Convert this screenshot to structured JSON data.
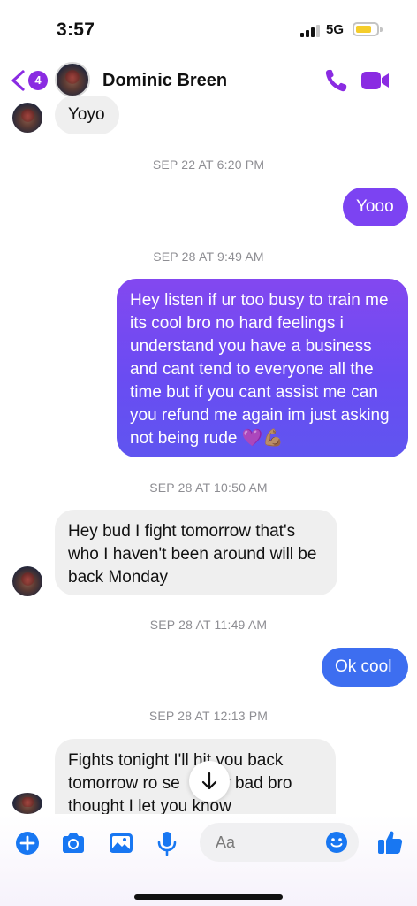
{
  "status_bar": {
    "time": "3:57",
    "network": "5G"
  },
  "header": {
    "back_badge": "4",
    "contact_name": "Dominic Breen"
  },
  "messages": [
    {
      "type": "incoming",
      "text": "Yoyo"
    },
    {
      "type": "timestamp",
      "text": "SEP 22 AT 6:20 PM"
    },
    {
      "type": "outgoing",
      "text": "Yooo"
    },
    {
      "type": "timestamp",
      "text": "SEP 28 AT 9:49 AM"
    },
    {
      "type": "outgoing",
      "text": "Hey listen if ur too busy to train me its cool bro no hard feelings i understand you have a business and cant tend to everyone all the time but if you cant assist me can you refund me again im just asking not being rude 💜💪🏽"
    },
    {
      "type": "timestamp",
      "text": "SEP 28 AT 10:50 AM"
    },
    {
      "type": "incoming",
      "text": "Hey bud I fight tomorrow that's who I haven't been around will be back Monday"
    },
    {
      "type": "timestamp",
      "text": "SEP 28 AT 11:49 AM"
    },
    {
      "type": "outgoing",
      "text": "Ok cool"
    },
    {
      "type": "timestamp",
      "text": "SEP 28 AT 12:13 PM"
    },
    {
      "type": "incoming",
      "text": "Fights tonight I'll hit you back tomorrow ro se      my bad bro thought I let you know"
    }
  ],
  "composer": {
    "placeholder": "Aa"
  },
  "icons": {
    "back": "chevron-left-icon",
    "call": "phone-icon",
    "video": "video-camera-icon",
    "add": "plus-circle-icon",
    "camera": "camera-icon",
    "gallery": "image-icon",
    "mic": "microphone-icon",
    "emoji": "smiley-icon",
    "like": "thumbs-up-icon",
    "scroll": "arrow-down-icon"
  },
  "colors": {
    "accent": "#8a2be2",
    "outgoing_blue": "#3d6ef0",
    "outgoing_violet": "#7c43f2",
    "composer_blue": "#1877f2"
  }
}
